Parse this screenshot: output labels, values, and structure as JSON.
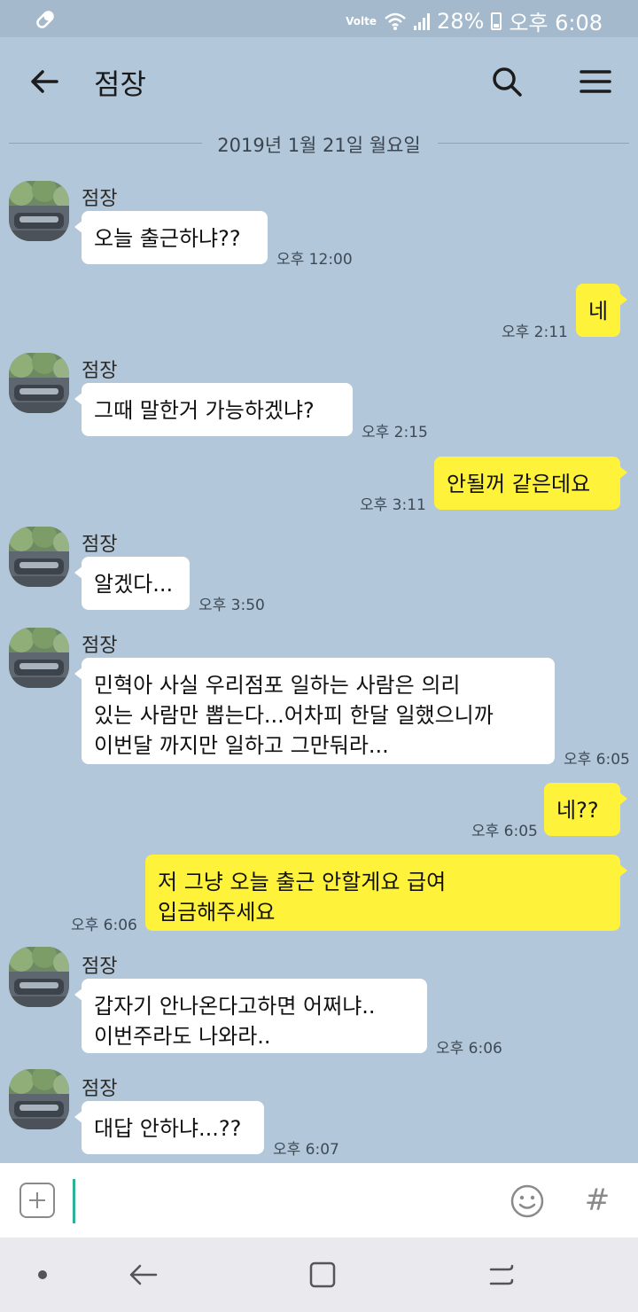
{
  "status_bar": {
    "volte": "Volte",
    "battery": "28%",
    "clock": "오후 6:08"
  },
  "header": {
    "title": "점장"
  },
  "date_divider": "2019년 1월 21일 월요일",
  "messages": [
    {
      "dir": "in",
      "sender": "점장",
      "text": "오늘 출근하냐??",
      "time": "오후 12:00"
    },
    {
      "dir": "out",
      "text": "네",
      "time": "오후 2:11"
    },
    {
      "dir": "in",
      "sender": "점장",
      "text": "그때 말한거 가능하겠냐?",
      "time": "오후 2:15"
    },
    {
      "dir": "out",
      "text": "안될꺼 같은데요",
      "time": "오후 3:11"
    },
    {
      "dir": "in",
      "sender": "점장",
      "text": "알겠다...",
      "time": "오후 3:50"
    },
    {
      "dir": "in",
      "sender": "점장",
      "text": "민혁아 사실 우리점포 일하는 사람은 의리\n있는 사람만 뽑는다...어차피 한달 일했으니까\n이번달 까지만 일하고 그만둬라...",
      "time": "오후 6:05"
    },
    {
      "dir": "out",
      "text": "네??",
      "time": "오후 6:05"
    },
    {
      "dir": "out",
      "text": "저 그냥 오늘 출근 안할게요 급여\n입금해주세요",
      "time": "오후 6:06"
    },
    {
      "dir": "in",
      "sender": "점장",
      "text": "갑자기 안나온다고하면 어쩌냐..\n이번주라도 나와라..",
      "time": "오후 6:06"
    },
    {
      "dir": "in",
      "sender": "점장",
      "text": "대답 안하냐...??",
      "time": "오후 6:07"
    }
  ],
  "input_bar": {
    "placeholder": "",
    "hash_label": "#"
  },
  "colors": {
    "background": "#b2c7d9",
    "outgoing_bubble": "#fff23a",
    "incoming_bubble": "#ffffff",
    "cursor": "#2bb39a"
  },
  "icons": [
    "pill-icon",
    "wifi-icon",
    "signal-icon",
    "battery-icon",
    "back-arrow-icon",
    "search-icon",
    "menu-icon",
    "plus-icon",
    "emoji-icon",
    "hash-icon",
    "nav-back-icon",
    "nav-recent-icon",
    "nav-home-icon"
  ]
}
